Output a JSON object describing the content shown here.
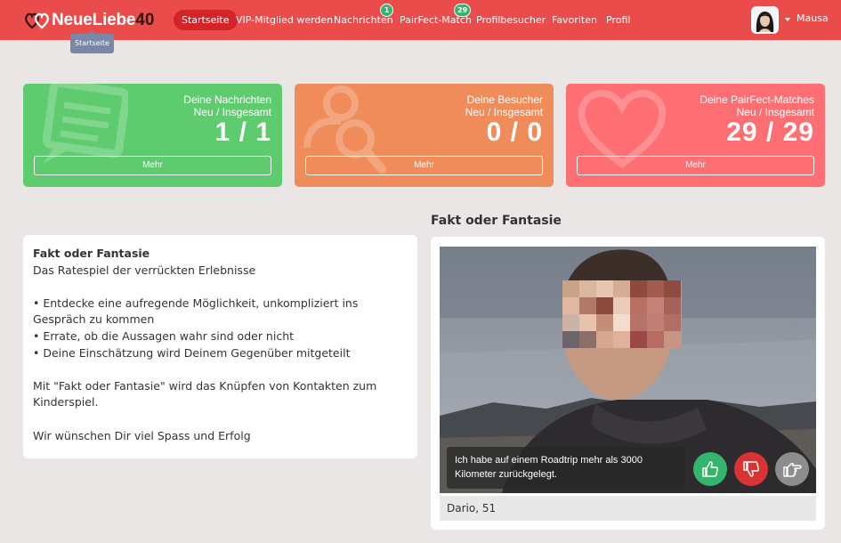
{
  "brand": {
    "name": "NeueLiebe",
    "number": "40"
  },
  "nav": {
    "items": [
      {
        "label": "Startseite",
        "active": true
      },
      {
        "label": "VIP-Mitglied werden"
      },
      {
        "label": "Nachrichten",
        "badge": "1"
      },
      {
        "label": "PairFect-Match",
        "badge": "29"
      },
      {
        "label": "Profilbesucher"
      },
      {
        "label": "Favoriten"
      },
      {
        "label": "Profil"
      }
    ],
    "tooltip": "Startseite"
  },
  "user": {
    "name": "Mausa"
  },
  "stats": [
    {
      "title": "Deine Nachrichten",
      "subtitle": "Neu / Insgesamt",
      "value": "1 / 1",
      "more": "Mehr",
      "color": "#5ecb6e",
      "icon": "message-icon"
    },
    {
      "title": "Deine Besucher",
      "subtitle": "Neu / Insgesamt",
      "value": "0 / 0",
      "more": "Mehr",
      "color": "#ef8c5a",
      "icon": "visitor-search-icon"
    },
    {
      "title": "Deine PairFect-Matches",
      "subtitle": "Neu / Insgesamt",
      "value": "29 / 29",
      "more": "Mehr",
      "color": "#fd6f72",
      "icon": "heart-icon"
    }
  ],
  "info": {
    "title": "Fakt oder Fantasie",
    "subtitle": "Das Ratespiel der verrückten Erlebnisse",
    "bullets": [
      "• Entdecke eine aufregende Möglichkeit, unkompliziert ins Gespräch zu kommen",
      "• Errate, ob die Aussagen wahr sind oder nicht",
      "• Deine Einschätzung wird Deinem Gegenüber mitgeteilt"
    ],
    "paragraph": "Mit \"Fakt oder Fantasie\" wird das Knüpfen von Kontakten zum Kinderspiel.",
    "closing": "Wir wünschen Dir viel Spass und Erfolg"
  },
  "game": {
    "heading": "Fakt oder Fantasie",
    "statement": "Ich habe auf einem Roadtrip mehr als 3000 Kilometer zurückgelegt.",
    "person": "Dario, 51",
    "buttons": {
      "up": "thumbs-up-icon",
      "down": "thumbs-down-icon",
      "skip": "point-right-icon"
    }
  },
  "colors": {
    "topbar": "#ea4b4b",
    "active_nav": "#d4242a",
    "badge": "#34b46c",
    "background": "#ebe6e6"
  }
}
